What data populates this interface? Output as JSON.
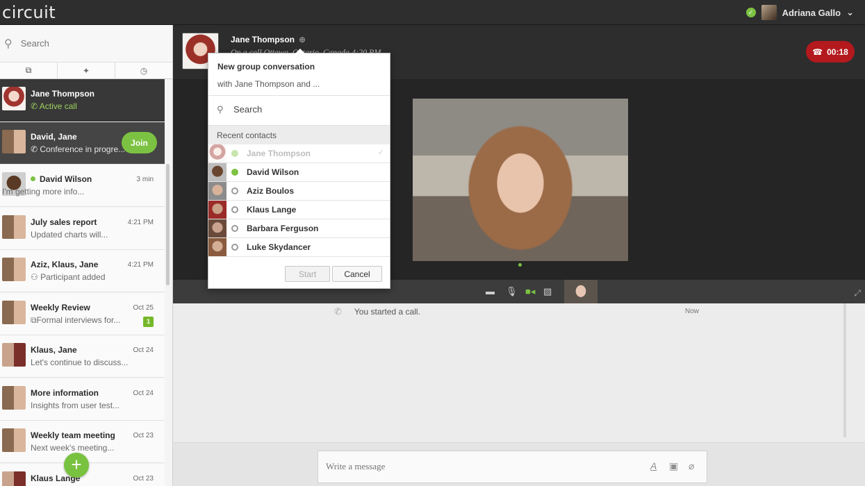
{
  "app": {
    "logo": "circuit"
  },
  "user": {
    "name": "Adriana Gallo",
    "chevron": "⌄",
    "status_color": "#7dc243"
  },
  "sidebar": {
    "search_placeholder": "Search",
    "conversations": [
      {
        "name": "Jane Thompson",
        "subtitle": "Active call",
        "icon": "phone-icon",
        "time": "",
        "badge": ""
      },
      {
        "name": "David, Jane",
        "subtitle": "Conference in progre...",
        "icon": "phone-icon",
        "join_label": "Join"
      },
      {
        "name": "David Wilson",
        "subtitle": "I'm getting more info...",
        "time": "3 min",
        "online": true
      },
      {
        "name": "July sales report",
        "subtitle": "Updated charts will...",
        "time": "4:21 PM"
      },
      {
        "name": "Aziz, Klaus, Jane",
        "subtitle": "Participant added",
        "time": "4:21 PM",
        "icon": "participant-icon"
      },
      {
        "name": "Weekly Review",
        "subtitle": "Formal interviews for...",
        "time": "Oct 25",
        "badge": "1",
        "icon": "conversation-icon"
      },
      {
        "name": "Klaus, Jane",
        "subtitle": "Let's continue to discuss...",
        "time": "Oct 24"
      },
      {
        "name": "More information",
        "subtitle": "Insights from user test...",
        "time": "Oct 24"
      },
      {
        "name": "Weekly team meeting",
        "subtitle": "Next week's meeting...",
        "time": "Oct 23"
      },
      {
        "name": "Klaus Lange",
        "subtitle": "",
        "time": "Oct 23"
      }
    ]
  },
  "header": {
    "contact_name": "Jane Thompson",
    "status_text": "On a call  Ottawa, Ontario, Canada  4:20 PM",
    "call_timer": "00:18"
  },
  "popup": {
    "title": "New group conversation",
    "subtitle": "with Jane Thompson and ...",
    "search_value": "Search",
    "recent_label": "Recent contacts",
    "contacts": [
      {
        "name": "Jane Thompson",
        "selected": true,
        "disabled": true
      },
      {
        "name": "David Wilson",
        "selected": true
      },
      {
        "name": "Aziz Boulos",
        "selected": false
      },
      {
        "name": "Klaus Lange",
        "selected": false
      },
      {
        "name": "Barbara Ferguson",
        "selected": false
      },
      {
        "name": "Luke Skydancer",
        "selected": false
      }
    ],
    "start_label": "Start",
    "cancel_label": "Cancel"
  },
  "chat": {
    "event_text": "You started a call.",
    "event_time": "Now",
    "composer_placeholder": "Write a message"
  },
  "colors": {
    "accent_green": "#7dc243",
    "call_red": "#b3191d"
  }
}
